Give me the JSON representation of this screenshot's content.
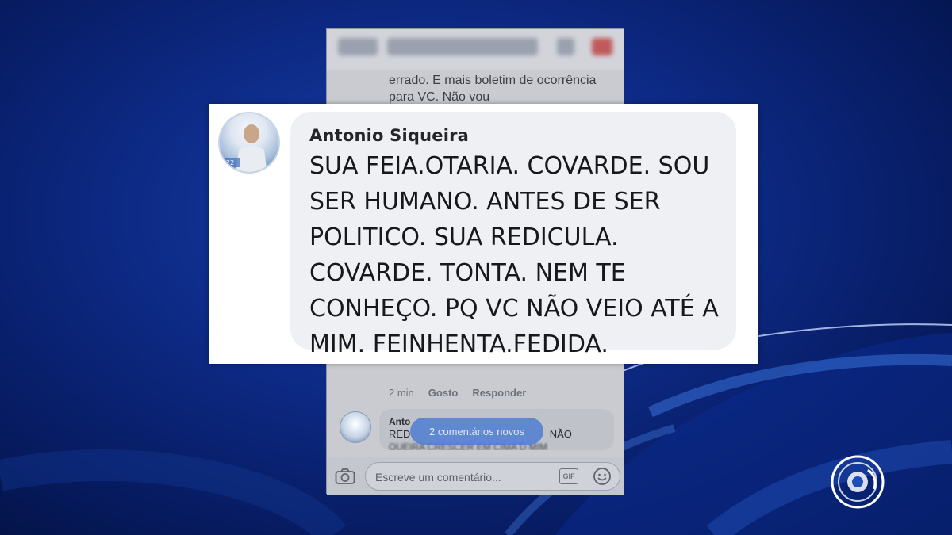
{
  "background": {
    "colors": {
      "deep": "#061a5e",
      "mid": "#1a3fa8",
      "swoosh": "#3c78e0"
    }
  },
  "phone": {
    "background_text": "errado. E mais boletim de ocorrência para VC. Não vou",
    "meta": {
      "time": "2 min",
      "like": "Gosto",
      "reply": "Responder"
    },
    "second_comment": {
      "name": "Anto",
      "text_visible": "RED",
      "text_tail": "NÃO",
      "text_blurred": "QUEIRA CRESCER EM CIMA D MIM"
    },
    "new_comments_pill": "2 comentários novos",
    "input": {
      "placeholder": "Escreve um comentário...",
      "gif_label": "GIF",
      "camera_icon": "camera-icon",
      "emoji_icon": "smiley-icon"
    }
  },
  "highlight": {
    "author": "Antonio Siqueira",
    "comment": "SUA FEIA.OTARIA. COVARDE. SOU SER HUMANO. ANTES DE SER POLITICO. SUA REDICULA. COVARDE. TONTA. NEM TE CONHEÇO. PQ VC NÃO VEIO ATÉ A MIM. FEINHENTA.FEDIDA."
  },
  "broadcaster_logo": "tv-logo-icon"
}
